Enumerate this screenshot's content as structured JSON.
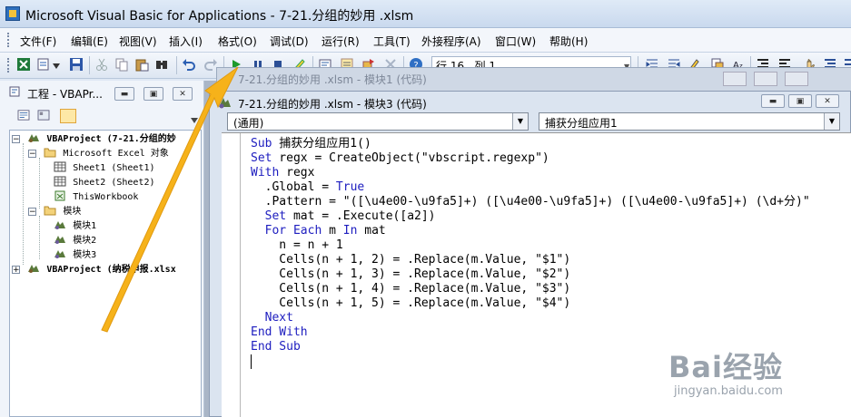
{
  "app": {
    "title": "Microsoft Visual Basic for Applications - 7-21.分组的妙用 .xlsm"
  },
  "menu": {
    "items": [
      {
        "label": "文件(F)"
      },
      {
        "label": "编辑(E)"
      },
      {
        "label": "视图(V)"
      },
      {
        "label": "插入(I)"
      },
      {
        "label": "格式(O)"
      },
      {
        "label": "调试(D)"
      },
      {
        "label": "运行(R)"
      },
      {
        "label": "工具(T)"
      },
      {
        "label": "外接程序(A)"
      },
      {
        "label": "窗口(W)"
      },
      {
        "label": "帮助(H)"
      }
    ]
  },
  "toolbar": {
    "cursor_position": "行 16 , 列 1",
    "icons": [
      "excel-icon",
      "insert-module-icon",
      "save-icon",
      "cut-icon",
      "copy-icon",
      "paste-icon",
      "find-icon",
      "undo-icon",
      "redo-icon",
      "run-icon",
      "break-icon",
      "reset-icon",
      "design-mode-icon",
      "project-explorer-icon",
      "properties-icon",
      "object-browser-icon",
      "toolbox-icon",
      "help-icon"
    ]
  },
  "project_panel": {
    "title": "工程 - VBAPr...",
    "tree": [
      {
        "label": "VBAProject (7-21.分组的妙",
        "bold": true
      },
      {
        "label": "Microsoft Excel 对象"
      },
      {
        "label": "Sheet1 (Sheet1)"
      },
      {
        "label": "Sheet2 (Sheet2)"
      },
      {
        "label": "ThisWorkbook"
      },
      {
        "label": "模块"
      },
      {
        "label": "模块1"
      },
      {
        "label": "模块2"
      },
      {
        "label": "模块3"
      },
      {
        "label": "VBAProject (纳税申报.xlsx",
        "bold": true
      }
    ]
  },
  "background_window": {
    "title": "7-21.分组的妙用 .xlsm - 模块1 (代码)"
  },
  "code_window": {
    "title": "7-21.分组的妙用 .xlsm - 模块3 (代码)",
    "object_combo": "(通用)",
    "procedure_combo": "捕获分组应用1",
    "lines": [
      "Sub 捕获分组应用1()",
      "Set regx = CreateObject(\"vbscript.regexp\")",
      "With regx",
      "  .Global = True",
      "  .Pattern = \"([\\u4e00-\\u9fa5]+) ([\\u4e00-\\u9fa5]+) ([\\u4e00-\\u9fa5]+) (\\d+分)\"",
      "  Set mat = .Execute([a2])",
      "  For Each m In mat",
      "    n = n + 1",
      "    Cells(n + 1, 2) = .Replace(m.Value, \"$1\")",
      "    Cells(n + 1, 3) = .Replace(m.Value, \"$2\")",
      "    Cells(n + 1, 4) = .Replace(m.Value, \"$3\")",
      "    Cells(n + 1, 5) = .Replace(m.Value, \"$4\")",
      "  Next",
      "End With",
      "End Sub"
    ]
  },
  "watermark": {
    "text": "Bai经验",
    "sub": "jingyan.baidu.com"
  },
  "colors": {
    "keyword": "#1d1dbf",
    "annotation_arrow": "#f6b21a"
  }
}
